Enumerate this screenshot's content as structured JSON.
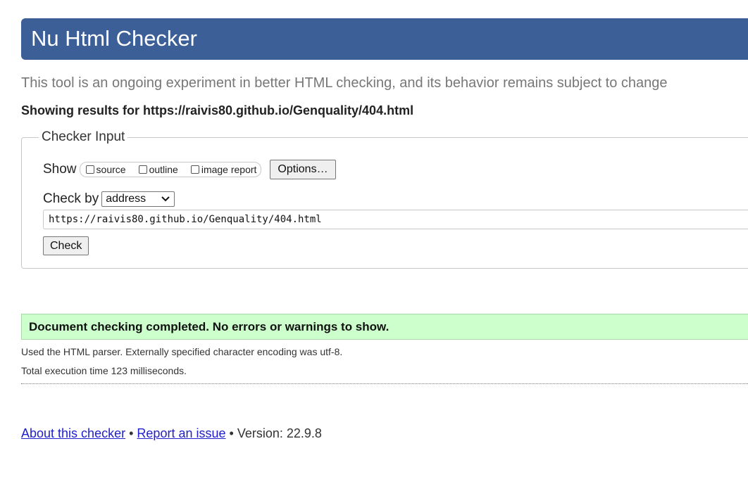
{
  "banner": {
    "title": "Nu Html Checker"
  },
  "tagline": "This tool is an ongoing experiment in better HTML checking, and its behavior remains subject to change",
  "showing_results": "Showing results for https://raivis80.github.io/Genquality/404.html",
  "checker": {
    "legend": "Checker Input",
    "show_label": "Show",
    "show_options": [
      {
        "label": "source",
        "checked": false
      },
      {
        "label": "outline",
        "checked": false
      },
      {
        "label": "image report",
        "checked": false
      }
    ],
    "options_button": "Options…",
    "check_by_label": "Check by",
    "check_by_value": "address",
    "url_value": "https://raivis80.github.io/Genquality/404.html",
    "check_button": "Check"
  },
  "result": {
    "success_message": "Document checking completed. No errors or warnings to show.",
    "parser_info": "Used the HTML parser. Externally specified character encoding was utf-8.",
    "execution_time": "Total execution time 123 milliseconds."
  },
  "footer": {
    "about_link": "About this checker",
    "separator": "•",
    "report_link": "Report an issue",
    "version": "Version: 22.9.8"
  },
  "colors": {
    "banner_bg": "#3d5f97",
    "success_bg": "#ccffcc",
    "link": "#2020cc"
  },
  "icons": {
    "select_chevron": "chevron-down-icon",
    "checkbox": "checkbox-icon"
  }
}
